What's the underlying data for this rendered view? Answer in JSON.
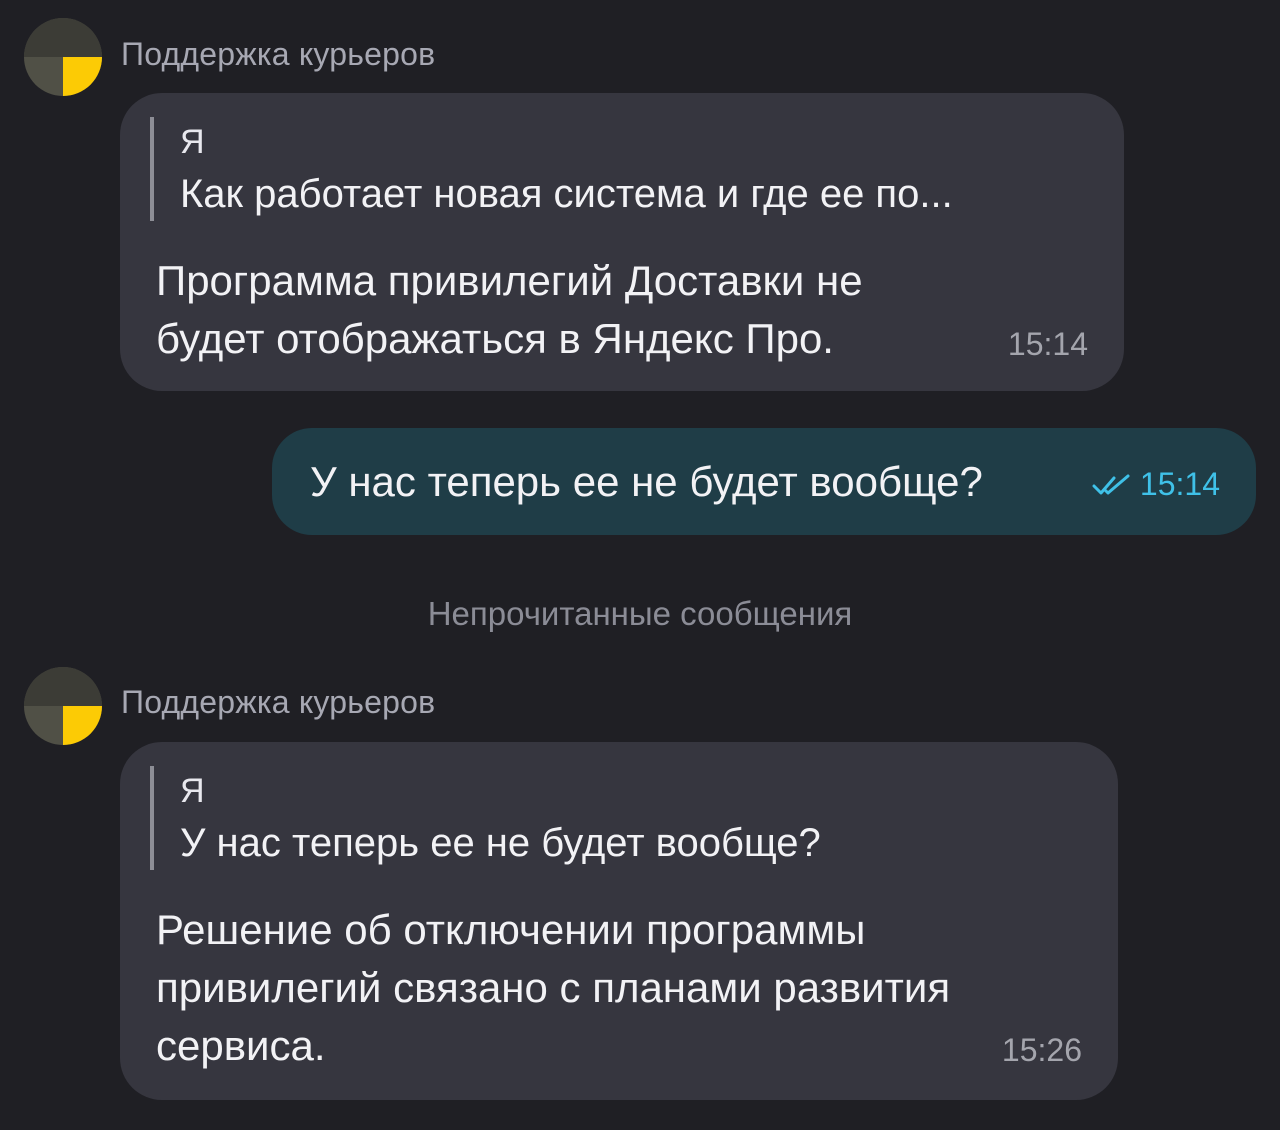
{
  "messages": [
    {
      "sender": "Поддержка курьеров",
      "quote_author": "Я",
      "quote_text": "Как работает новая система и где ее по...",
      "body_line1": "Программа привилегий Доставки не",
      "body_line2": "будет отображаться в Яндекс Про.",
      "time": "15:14"
    },
    {
      "text": "У нас теперь ее не будет вообще?",
      "time": "15:14",
      "status": "read",
      "check_color": "#3fc1e8"
    },
    {
      "sender": "Поддержка курьеров",
      "quote_author": "Я",
      "quote_text": "У нас теперь ее не будет вообще?",
      "body_line1": "Решение об отключении программы",
      "body_line2": "привилегий связано с планами развития",
      "body_line3": "сервиса.",
      "time": "15:26"
    }
  ],
  "divider": "Непрочитанные сообщения",
  "colors": {
    "background": "#1f1f24",
    "incoming_bubble": "#36363f",
    "outgoing_bubble": "#1f3d47",
    "avatar_accent": "#fccb05"
  },
  "icons": {
    "avatar": "support-logo-icon",
    "read_status": "double-check-icon"
  }
}
